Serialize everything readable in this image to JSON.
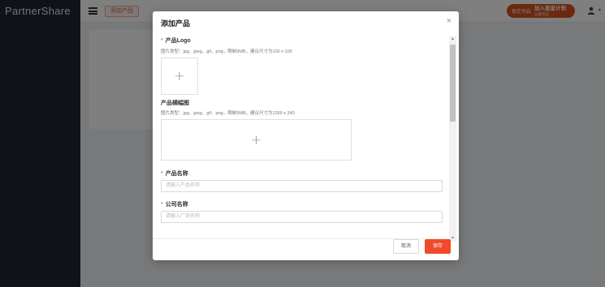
{
  "app": {
    "logo": "PartnerShare",
    "nav_tag": "添加产品",
    "promo_prefix": "现在开启",
    "promo_strong": "加入星星计划",
    "promo_sub": "立即开启",
    "user_caret": "▾"
  },
  "modal": {
    "title": "添加产品",
    "close": "×",
    "fields": {
      "logo": {
        "required_mark": "*",
        "label": "产品Logo",
        "hint": "图片类型：jpg、jpeg、gif、png，限制5MB，建议尺寸为100 x 100"
      },
      "banner": {
        "label": "产品横幅图",
        "hint": "图片类型：jpg、jpeg、gif、png，限制5MB，建议尺寸为1260 x 240"
      },
      "product_name": {
        "required_mark": "*",
        "label": "产品名称",
        "placeholder": "请输入产品名称"
      },
      "company_name": {
        "required_mark": "*",
        "label": "公司名称",
        "placeholder": "请输入厂商名称"
      }
    },
    "upload_plus": "+",
    "cancel_label": "取消",
    "save_label": "保存"
  },
  "colors": {
    "sidebar": "#1f2430",
    "accent": "#f04a2a",
    "promo": "#d9531e"
  }
}
